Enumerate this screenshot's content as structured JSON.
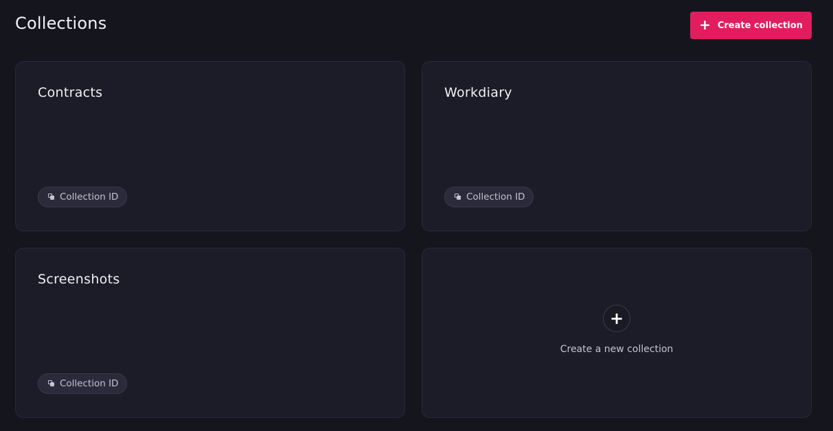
{
  "header": {
    "title": "Collections",
    "create_button": {
      "icon": "plus-icon",
      "icon_glyph": "+",
      "label": "Create collection",
      "color": "#e11d5f"
    }
  },
  "collections": [
    {
      "name": "Contracts",
      "id_chip_label": "Collection ID",
      "id_chip_icon": "copy-icon"
    },
    {
      "name": "Workdiary",
      "id_chip_label": "Collection ID",
      "id_chip_icon": "copy-icon"
    },
    {
      "name": "Screenshots",
      "id_chip_label": "Collection ID",
      "id_chip_icon": "copy-icon"
    }
  ],
  "new_collection_card": {
    "icon": "plus-icon",
    "icon_glyph": "+",
    "label": "Create a new collection"
  },
  "colors": {
    "background": "#15151e",
    "card": "#1c1c28",
    "accent": "#e11d5f"
  }
}
